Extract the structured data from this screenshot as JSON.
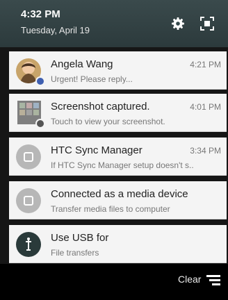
{
  "header": {
    "time": "4:32 PM",
    "date": "Tuesday, April 19",
    "icons": [
      "settings-icon",
      "screenshot-icon"
    ]
  },
  "notifications": [
    {
      "title": "Angela Wang",
      "subtitle": "Urgent! Please reply...",
      "time": "4:21 PM",
      "icon": "avatar-photo",
      "badge": "message-badge"
    },
    {
      "title": "Screenshot captured.",
      "subtitle": "Touch to view your screenshot.",
      "time": "4:01 PM",
      "icon": "screenshot-thumbnail",
      "badge": "screenshot-badge"
    },
    {
      "title": "HTC Sync Manager",
      "subtitle": "If HTC Sync Manager setup doesn't s..",
      "time": "3:34 PM",
      "icon": "sync-icon"
    },
    {
      "title": "Connected as a media device",
      "subtitle": "Transfer media files to computer",
      "time": "",
      "icon": "media-icon"
    },
    {
      "title": "Use USB for",
      "subtitle": "File transfers",
      "time": "",
      "icon": "usb-icon"
    }
  ],
  "footer": {
    "clear_label": "Clear"
  },
  "colors": {
    "header": "#33474a",
    "card": "#f4f4f4",
    "badge": "#3f5fb0",
    "usb_circle": "#2a3a3a"
  }
}
